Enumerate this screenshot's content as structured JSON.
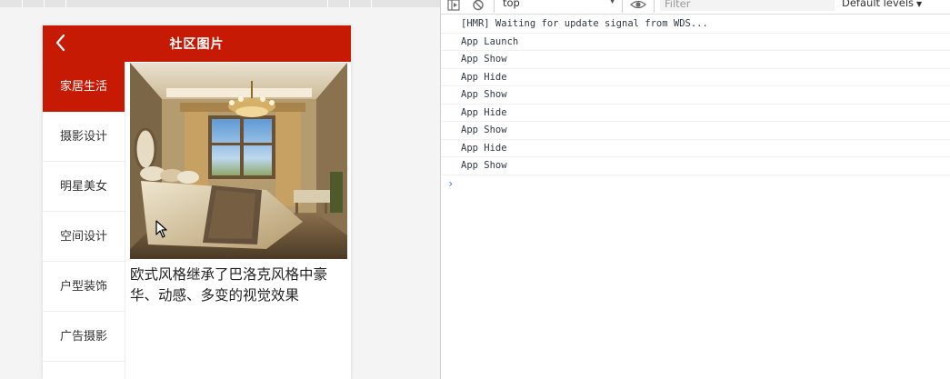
{
  "app": {
    "nav_title": "社区图片",
    "back_icon": "chevron-left-icon",
    "brand_color": "#c71a04"
  },
  "categories": [
    {
      "label": "家居生活",
      "active": true
    },
    {
      "label": "摄影设计",
      "active": false
    },
    {
      "label": "明星美女",
      "active": false
    },
    {
      "label": "空间设计",
      "active": false
    },
    {
      "label": "户型装饰",
      "active": false
    },
    {
      "label": "广告摄影",
      "active": false
    }
  ],
  "content": {
    "image_caption": "欧式风格继承了巴洛克风格中豪华、动感、多变的视觉效果"
  },
  "devtools": {
    "context": "top",
    "filter_placeholder": "Filter",
    "levels_label": "Default levels",
    "logs": [
      "[HMR] Waiting for update signal from WDS...",
      "App Launch",
      "App Show",
      "App Hide",
      "App Show",
      "App Hide",
      "App Show",
      "App Hide",
      "App Show"
    ],
    "prompt": "›"
  }
}
